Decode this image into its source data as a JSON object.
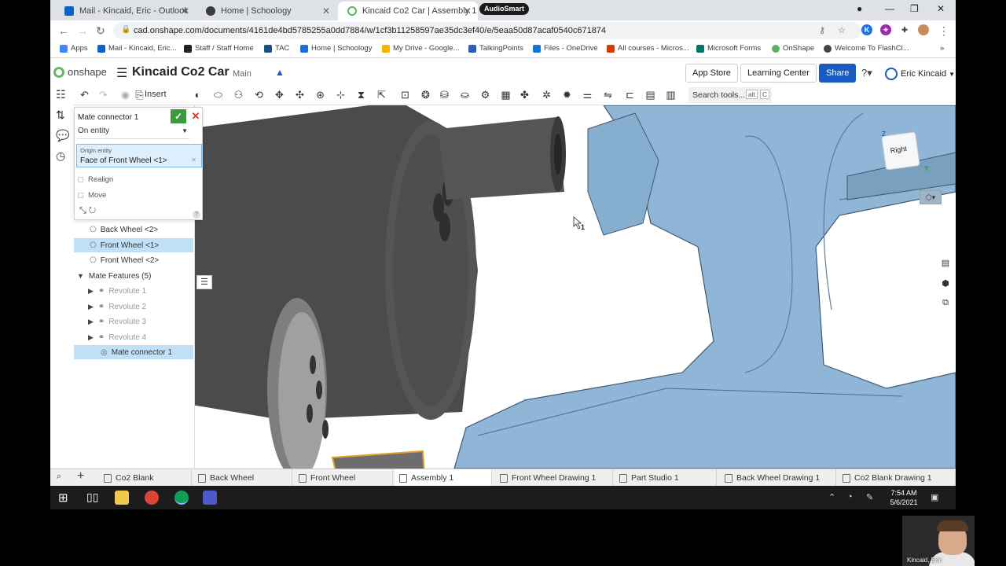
{
  "browser": {
    "tabs": [
      {
        "label": "Mail - Kincaid, Eric - Outlook",
        "color": "#0a64c8"
      },
      {
        "label": "Home | Schoology",
        "color": "#3b3b3b"
      },
      {
        "label": "Kincaid Co2 Car | Assembly 1",
        "color": "#5fae63"
      }
    ],
    "tab_close": "✕",
    "audiosmart_label": "AudioSmart",
    "url": "cad.onshape.com/documents/4161de4bd5785255a0dd7884/w/1cf3b11258597ae35dc3ef40/e/5eaa50d87acaf0540c671874",
    "bookmarks": [
      {
        "label": "Apps",
        "color": "#4285f4"
      },
      {
        "label": "Mail - Kincaid, Eric...",
        "color": "#0a64c8"
      },
      {
        "label": "Staff / Staff Home",
        "color": "#222222"
      },
      {
        "label": "TAC",
        "color": "#1d4e89"
      },
      {
        "label": "Home | Schoology",
        "color": "#1e6fd9"
      },
      {
        "label": "My Drive - Google...",
        "color": "#f4b400"
      },
      {
        "label": "TalkingPoints",
        "color": "#2b5fb3"
      },
      {
        "label": "Files - OneDrive",
        "color": "#0f78d4"
      },
      {
        "label": "All courses - Micros...",
        "color": "#d83b01"
      },
      {
        "label": "Microsoft Forms",
        "color": "#077568"
      },
      {
        "label": "OnShape",
        "color": "#5fae63"
      },
      {
        "label": "Welcome To FlashCl...",
        "color": "#444444"
      }
    ]
  },
  "onshape": {
    "logo_text": "onshape",
    "document_title": "Kincaid Co2 Car",
    "branch": "Main",
    "app_store": "App Store",
    "learning_center": "Learning Center",
    "share": "Share",
    "user_name": "Eric Kincaid",
    "insert_label": "Insert",
    "search_tools": "Search tools...",
    "search_shortcut_1": "alt",
    "search_shortcut_2": "C"
  },
  "dialog": {
    "title": "Mate connector 1",
    "mode": "On entity",
    "origin_label": "Origin entity",
    "origin_value": "Face of Front Wheel <1>",
    "realign": "Realign",
    "move": "Move"
  },
  "tree": {
    "items": [
      {
        "label": "Back Wheel <2>",
        "selected": false
      },
      {
        "label": "Front Wheel <1>",
        "selected": true
      },
      {
        "label": "Front Wheel <2>",
        "selected": false
      }
    ],
    "mate_features_label": "Mate Features (5)",
    "mates": [
      {
        "label": "Revolute 1"
      },
      {
        "label": "Revolute 2"
      },
      {
        "label": "Revolute 3"
      },
      {
        "label": "Revolute 4"
      }
    ],
    "mate_connector": "Mate connector 1"
  },
  "viewcube": {
    "face": "Right",
    "axis_z": "Z",
    "axis_y": "Y"
  },
  "cursor_label": "1",
  "bottom_tabs": [
    {
      "label": "Co2 Blank",
      "active": false
    },
    {
      "label": "Back Wheel",
      "active": false
    },
    {
      "label": "Front Wheel",
      "active": false
    },
    {
      "label": "Assembly 1",
      "active": true
    },
    {
      "label": "Front Wheel Drawing 1",
      "active": false
    },
    {
      "label": "Part Studio 1",
      "active": false
    },
    {
      "label": "Back Wheel Drawing 1",
      "active": false
    },
    {
      "label": "Co2 Blank Drawing 1",
      "active": false
    }
  ],
  "taskbar": {
    "time": "7:54 AM",
    "date": "5/6/2021"
  },
  "webcam": {
    "name": "Kincaid, Eric"
  },
  "colors": {
    "onshape_blue": "#1a5bbf",
    "part_blue": "#8fb6d6",
    "selection_blue": "#bfe0f6",
    "confirm_green": "#3a9a3c"
  }
}
